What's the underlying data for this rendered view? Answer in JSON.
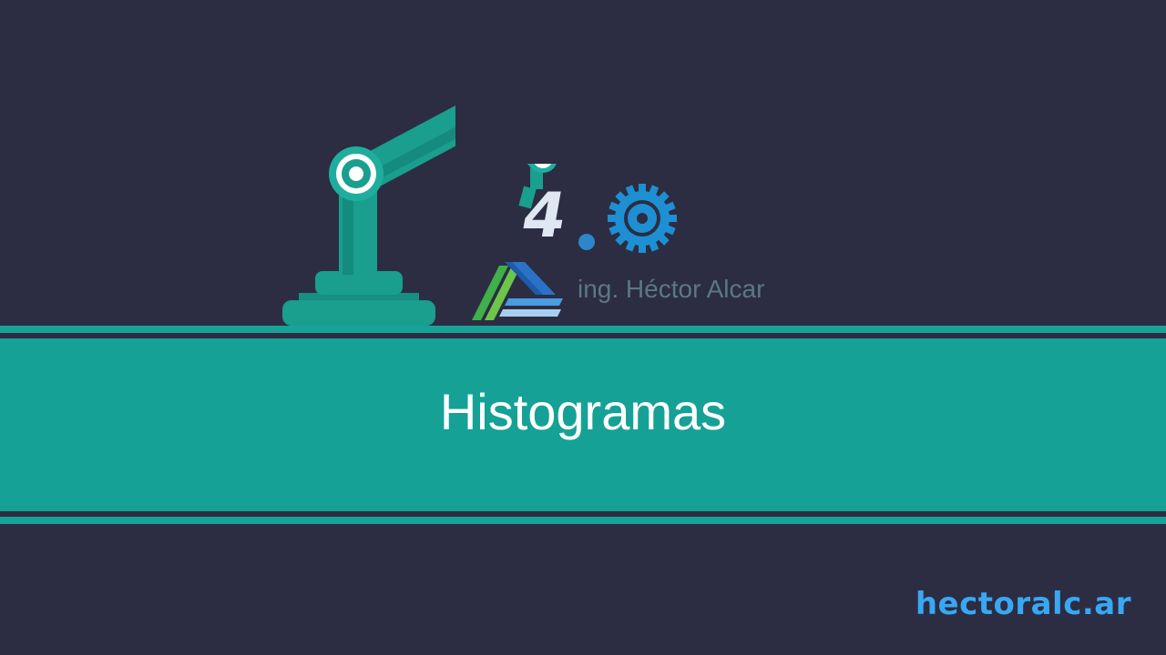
{
  "slide": {
    "title": "Histogramas",
    "author": "ing. Héctor Alcar",
    "logo_text": "4.0",
    "website": "hectoralc.ar"
  },
  "icons": {
    "robot": "robot-arm-icon",
    "gear": "gear-icon",
    "author_logo": "author-logo-icon"
  },
  "colors": {
    "background": "#2c2d42",
    "teal": "#16a196",
    "robot": "#1a9e8e",
    "title_text": "#ffffff",
    "author_text": "#5b7788",
    "website_text": "#39a7f2"
  }
}
